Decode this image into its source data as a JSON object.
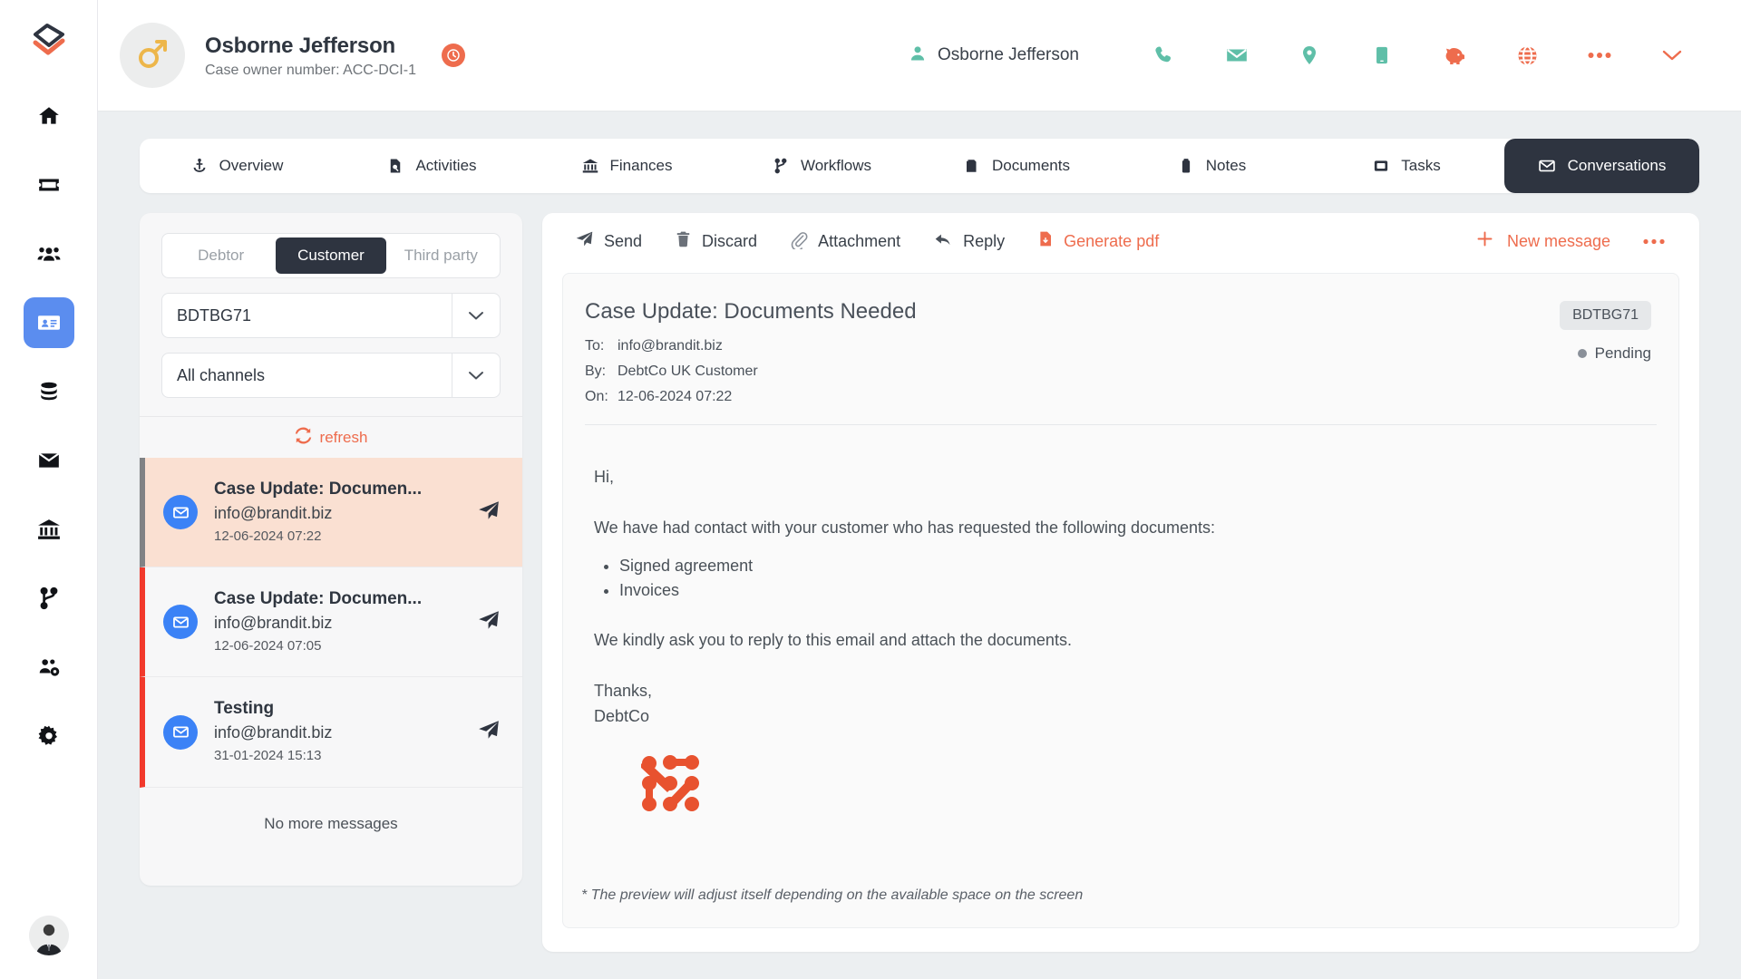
{
  "colors": {
    "accent_orange": "#ee6c4d",
    "dark": "#2e3440",
    "blue_active": "#5b8def",
    "msg_icon_blue": "#3b82f6",
    "selected_row_bg": "#fae0d2",
    "unread_bar_red": "#f2392c",
    "teal_icon": "#5fbfa8",
    "avatar_gold": "#edb64a"
  },
  "sidebar": {
    "logo": "app-logo",
    "items": [
      {
        "icon": "home-icon",
        "name": "home"
      },
      {
        "icon": "ticket-icon",
        "name": "tickets"
      },
      {
        "icon": "people-icon",
        "name": "people"
      },
      {
        "icon": "id-card-icon",
        "name": "cases",
        "active": true
      },
      {
        "icon": "database-icon",
        "name": "database"
      },
      {
        "icon": "envelope-icon",
        "name": "mail"
      },
      {
        "icon": "bank-icon",
        "name": "bank"
      },
      {
        "icon": "workflow-branch-icon",
        "name": "workflows"
      },
      {
        "icon": "team-settings-icon",
        "name": "teams"
      },
      {
        "icon": "gear-icon",
        "name": "settings"
      }
    ],
    "avatar": "user-avatar"
  },
  "header": {
    "case_avatar_icon": "male-gender-icon",
    "case_name": "Osborne Jefferson",
    "case_subtitle": "Case owner number: ACC-DCI-1",
    "case_badge_icon": "clock-badge-icon",
    "user_name": "Osborne Jefferson",
    "user_icon": "person-icon",
    "icons": [
      {
        "name": "phone-icon",
        "color": "#5fbfa8"
      },
      {
        "name": "email-icon",
        "color": "#5fbfa8"
      },
      {
        "name": "location-pin-icon",
        "color": "#5fbfa8"
      },
      {
        "name": "mobile-phone-icon",
        "color": "#5fbfa8"
      },
      {
        "name": "piggy-bank-icon",
        "color": "#ee6c4d"
      },
      {
        "name": "globe-icon",
        "color": "#ee6c4d"
      },
      {
        "name": "more-dots-icon",
        "color": "#ee6c4d"
      },
      {
        "name": "chevron-down-icon",
        "color": "#ee6c4d"
      }
    ]
  },
  "tabs": [
    {
      "label": "Overview",
      "icon": "anchor-icon",
      "active": false
    },
    {
      "label": "Activities",
      "icon": "document-search-icon",
      "active": false
    },
    {
      "label": "Finances",
      "icon": "bank-icon",
      "active": false
    },
    {
      "label": "Workflows",
      "icon": "branch-icon",
      "active": false
    },
    {
      "label": "Documents",
      "icon": "folder-icon",
      "active": false
    },
    {
      "label": "Notes",
      "icon": "note-icon",
      "active": false
    },
    {
      "label": "Tasks",
      "icon": "task-icon",
      "active": false
    },
    {
      "label": "Conversations",
      "icon": "envelope-icon",
      "active": true
    }
  ],
  "list_pane": {
    "segments": [
      {
        "label": "Debtor",
        "active": false
      },
      {
        "label": "Customer",
        "active": true
      },
      {
        "label": "Third party",
        "active": false
      }
    ],
    "case_select": {
      "value": "BDTBG71",
      "arrow": "chevron-down-icon"
    },
    "channel_select": {
      "value": "All channels",
      "arrow": "chevron-down-icon"
    },
    "refresh_label": "refresh",
    "refresh_icon": "refresh-icon",
    "messages": [
      {
        "subject": "Case Update: Documen...",
        "from": "info@brandit.biz",
        "date": "12-06-2024 07:22",
        "icon": "envelope-icon",
        "send_icon": "paper-plane-icon",
        "selected": true,
        "bar_color": "#808285"
      },
      {
        "subject": "Case Update: Documen...",
        "from": "info@brandit.biz",
        "date": "12-06-2024 07:05",
        "icon": "envelope-icon",
        "send_icon": "paper-plane-icon",
        "selected": false,
        "bar_color": "#f2392c"
      },
      {
        "subject": "Testing",
        "from": "info@brandit.biz",
        "date": "31-01-2024 15:13",
        "icon": "envelope-icon",
        "send_icon": "paper-plane-icon",
        "selected": false,
        "bar_color": "#f2392c"
      }
    ],
    "no_more_label": "No more messages"
  },
  "mail_toolbar": {
    "buttons": [
      {
        "label": "Send",
        "icon": "paper-plane-icon",
        "accent": false
      },
      {
        "label": "Discard",
        "icon": "trash-icon",
        "accent": false
      },
      {
        "label": "Attachment",
        "icon": "paperclip-icon",
        "accent": false
      },
      {
        "label": "Reply",
        "icon": "reply-arrow-icon",
        "accent": false
      },
      {
        "label": "Generate pdf",
        "icon": "pdf-file-icon",
        "accent": true
      }
    ],
    "new_message_label": "New message",
    "new_message_icon": "plus-icon",
    "more_icon": "more-dots-icon"
  },
  "mail": {
    "title": "Case Update: Documents Needed",
    "meta": [
      {
        "label": "To:",
        "value": "info@brandit.biz"
      },
      {
        "label": "By:",
        "value": "DebtCo UK Customer"
      },
      {
        "label": "On:",
        "value": "12-06-2024 07:22"
      }
    ],
    "reference_badge": "BDTBG71",
    "status": "Pending",
    "body": {
      "greeting": "Hi,",
      "intro": "We have had contact with your customer who has requested the following documents:",
      "bullets": [
        "Signed agreement",
        "Invoices"
      ],
      "request": "We kindly ask you to reply to this email and attach the documents.",
      "sign_off": "Thanks,",
      "sign_name": "DebtCo",
      "logo_icon": "brandit-nodes-logo"
    },
    "footnote": "* The preview will adjust itself depending on the available space on the screen"
  }
}
